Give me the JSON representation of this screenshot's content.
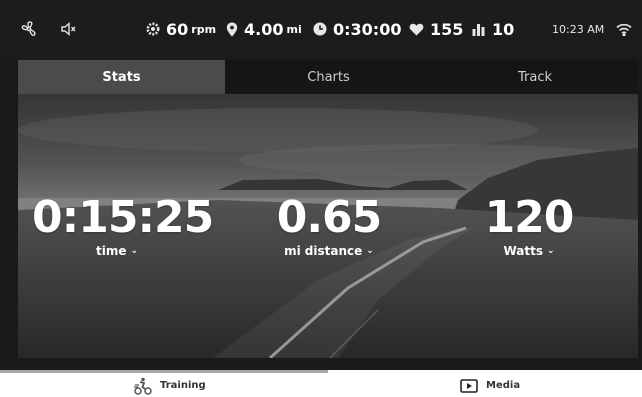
{
  "status": {
    "cadence": {
      "value": "60",
      "unit": "rpm"
    },
    "distance": {
      "value": "4.00",
      "unit": "mi"
    },
    "duration": {
      "value": "0:30:00"
    },
    "heart_rate": {
      "value": "155"
    },
    "level": {
      "value": "10"
    },
    "clock": "10:23 AM"
  },
  "tabs": [
    {
      "label": "Stats",
      "active": true
    },
    {
      "label": "Charts",
      "active": false
    },
    {
      "label": "Track",
      "active": false
    }
  ],
  "stats": [
    {
      "value": "0:15:25",
      "unit": "",
      "label": "time"
    },
    {
      "value": "0.65",
      "unit": "mi",
      "label": "distance"
    },
    {
      "value": "120",
      "unit": "",
      "label": "Watts"
    }
  ],
  "bottom_nav": {
    "training_label": "Training",
    "media_label": "Media",
    "active": "Training"
  }
}
